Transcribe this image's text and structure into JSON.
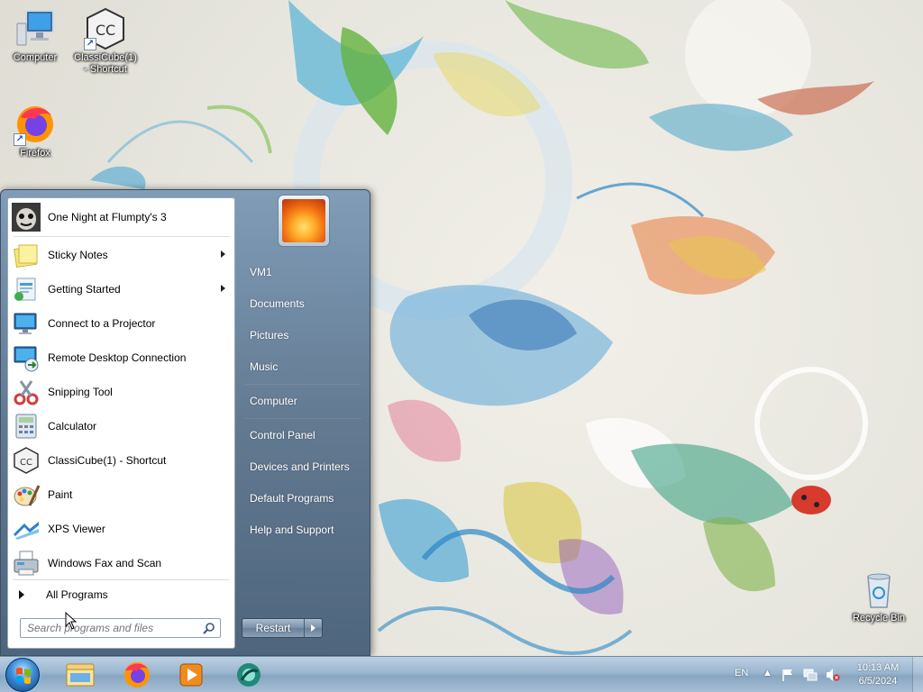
{
  "desktop": {
    "icons": [
      {
        "label": "Computer",
        "icon": "computer-icon"
      },
      {
        "label": "ClassiCube(1) - Shortcut",
        "icon": "classicube-icon"
      },
      {
        "label": "Firefox",
        "icon": "firefox-icon"
      },
      {
        "label": "Recycle Bin",
        "icon": "recycle-bin-icon"
      }
    ]
  },
  "start_menu": {
    "pinned": {
      "label": "One Night at Flumpty's 3",
      "icon": "flumpty-icon"
    },
    "programs": [
      {
        "label": "Sticky Notes",
        "icon": "sticky-notes-icon",
        "has_submenu": true
      },
      {
        "label": "Getting Started",
        "icon": "getting-started-icon",
        "has_submenu": true
      },
      {
        "label": "Connect to a Projector",
        "icon": "projector-icon",
        "has_submenu": false
      },
      {
        "label": "Remote Desktop Connection",
        "icon": "remote-desktop-icon",
        "has_submenu": false
      },
      {
        "label": "Snipping Tool",
        "icon": "snipping-tool-icon",
        "has_submenu": false
      },
      {
        "label": "Calculator",
        "icon": "calculator-icon",
        "has_submenu": false
      },
      {
        "label": "ClassiCube(1) - Shortcut",
        "icon": "classicube-icon",
        "has_submenu": false
      },
      {
        "label": "Paint",
        "icon": "paint-icon",
        "has_submenu": false
      },
      {
        "label": "XPS Viewer",
        "icon": "xps-viewer-icon",
        "has_submenu": false
      },
      {
        "label": "Windows Fax and Scan",
        "icon": "fax-scan-icon",
        "has_submenu": false
      }
    ],
    "all_programs": "All Programs",
    "search_placeholder": "Search programs and files",
    "right_items": [
      "VM1",
      "Documents",
      "Pictures",
      "Music",
      "Computer",
      "Control Panel",
      "Devices and Printers",
      "Default Programs",
      "Help and Support"
    ],
    "restart_label": "Restart"
  },
  "taskbar": {
    "pinned": [
      "windows-explorer-icon",
      "firefox-icon",
      "media-player-icon",
      "app-icon"
    ],
    "language": "EN",
    "time": "10:13 AM",
    "date": "6/5/2024"
  },
  "colors": {
    "taskbar": "#9bb6cf",
    "start_menu_right": "#5a738c",
    "orb": "#3a8ad6"
  }
}
